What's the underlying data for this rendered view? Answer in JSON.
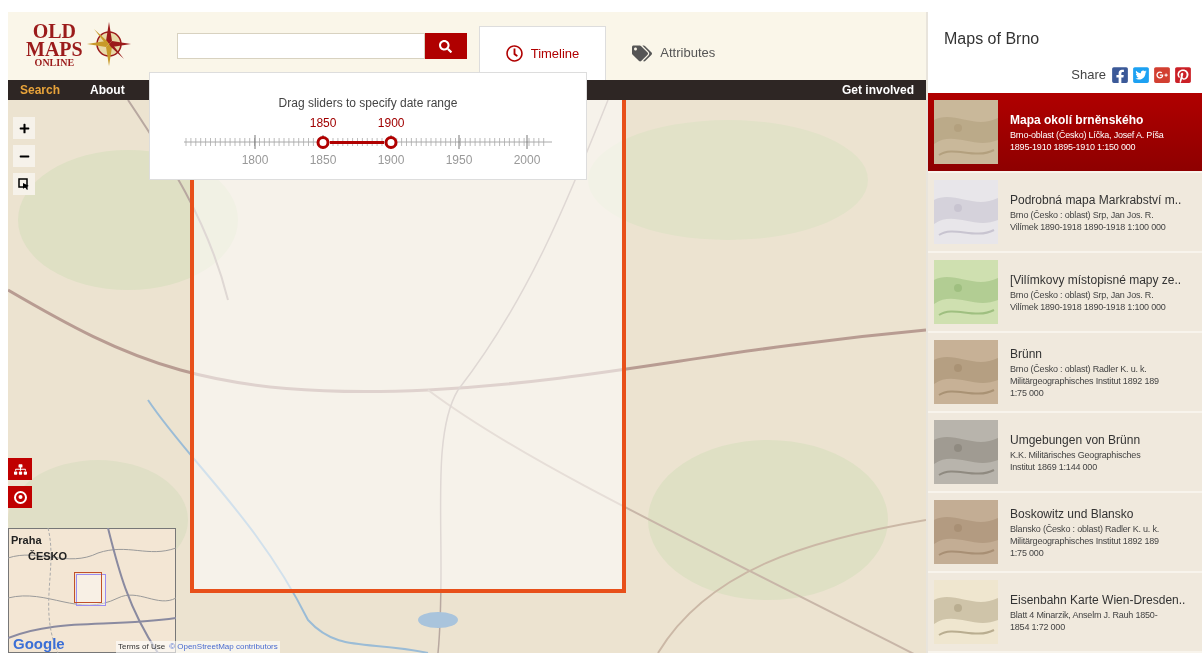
{
  "logo": {
    "line_1": "OLD",
    "line_2": "MAPS",
    "line_3": "ONLINE"
  },
  "tabs": [
    {
      "label": "Timeline",
      "selected": true,
      "kind": "timeline"
    },
    {
      "label": "Attributes",
      "selected": false,
      "kind": "attributes"
    }
  ],
  "nav": [
    {
      "label": "Search",
      "selected": true
    },
    {
      "label": "About",
      "selected": false
    }
  ],
  "nav_right": "Get involved",
  "timeline": {
    "title": "Drag sliders to specify date range",
    "thumbs": [
      {
        "label": "1850",
        "level": 0.378
      },
      {
        "label": "1900",
        "level": 0.563
      }
    ],
    "ticks": [
      "1800",
      "1850",
      "1900",
      "1950",
      "2000"
    ]
  },
  "minimap": {
    "labels": [
      "Praha",
      "ČESKO"
    ]
  },
  "attribution": {
    "logo": "Google",
    "terms": "Terms of Use",
    "copyright": "© OpenStreetMap contributors"
  },
  "panel": {
    "title_prefix": "Maps of",
    "title_place": "Brno",
    "share": "Share"
  },
  "results": [
    {
      "title": "Mapa okolí brněnského",
      "lines": [
        "Brno-oblast (Česko) Líčka, Josef A. Píša",
        "1895-1910 1895-1910 1:150 000"
      ],
      "selected": true,
      "kind": "picture"
    },
    {
      "title": "Podrobná mapa Markrabství m..",
      "lines": [
        "Brno (Česko : oblast) Srp, Jan Jos. R.",
        "Vilímek 1890-1918 1890-1918 1:100 000"
      ],
      "selected": false,
      "kind": "picture"
    },
    {
      "title": "[Vilímkovy místopisné mapy ze..",
      "lines": [
        "Brno (Česko : oblast) Srp, Jan Jos. R.",
        "Vilímek 1890-1918 1890-1918 1:100 000"
      ],
      "selected": false,
      "kind": "picture"
    },
    {
      "title": "Brünn",
      "lines": [
        "Brno (Česko : oblast) Radler K. u. k.",
        "Militärgeographisches Institut 1892 189",
        "1:75 000"
      ],
      "selected": false,
      "kind": "picture"
    },
    {
      "title": "Umgebungen von Brünn",
      "lines": [
        "K.K. Militärisches Geographisches",
        "Institut 1869 1:144 000"
      ],
      "selected": false,
      "kind": "picture"
    },
    {
      "title": "Boskowitz und Blansko",
      "lines": [
        "Blansko (Česko : oblast) Radler K. u. k.",
        "Militärgeographisches Institut 1892 189",
        "1:75 000"
      ],
      "selected": false,
      "kind": "picture"
    },
    {
      "title": "Eisenbahn Karte Wien-Dresden..",
      "lines": [
        "Blatt 4 Minarzik, Anselm J. Rauh 1850-",
        "1854 1:72 000"
      ],
      "selected": false,
      "kind": "picture"
    }
  ]
}
